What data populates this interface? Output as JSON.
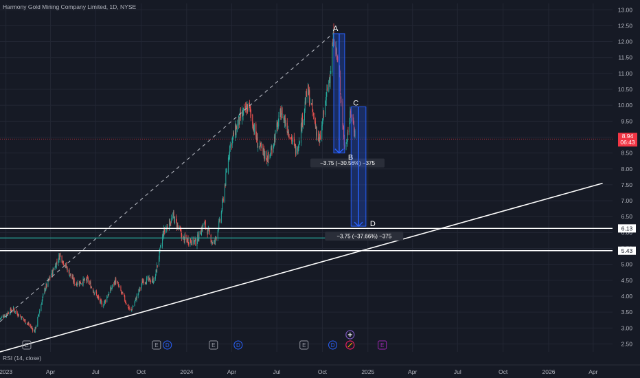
{
  "chart_title": "Harmony Gold Mining Company Limited, 1D, NYSE",
  "indicator_label": "RSI (14, close)",
  "last_price": {
    "value": "8.94",
    "countdown": "06:43"
  },
  "level_labels": {
    "upper": "6.13",
    "lower": "5.43"
  },
  "point_labels": {
    "a": "A",
    "b": "B",
    "c": "C",
    "d": "D"
  },
  "measure_labels": {
    "ab": "−3.75 (−30.56%) −375",
    "cd": "−3.75 (−37.66%) −375"
  },
  "event_marks": [
    "E",
    "E",
    "D",
    "E",
    "D",
    "E",
    "D",
    "E"
  ],
  "colors": {
    "background": "#161a25",
    "up": "#26a69a",
    "down": "#ef5350",
    "measure": "#2962ff",
    "last_price": "#f23645",
    "level": "#ffffff",
    "trendline": "#ffffff",
    "dashed": "#b2b5be",
    "earnings_future": "#9c27b0"
  },
  "icons": [
    "dividend-icon",
    "earnings-icon",
    "plus-icon",
    "split-icon"
  ],
  "chart_data": {
    "type": "candlestick",
    "title": "Harmony Gold Mining Company Limited, 1D, NYSE",
    "x_range": [
      "2022-12-20",
      "2026-05-10"
    ],
    "y_range": [
      2.25,
      13.2
    ],
    "y_ticks": [
      "2.50",
      "3.00",
      "3.50",
      "4.00",
      "4.50",
      "5.00",
      "5.50",
      "6.00",
      "6.50",
      "7.00",
      "7.50",
      "8.00",
      "8.50",
      "9.00",
      "9.50",
      "10.00",
      "10.50",
      "11.00",
      "11.50",
      "12.00",
      "12.50",
      "13.00"
    ],
    "x_ticks": [
      {
        "label": "2023",
        "x": "2023-01-01"
      },
      {
        "label": "Apr",
        "x": "2023-04-01"
      },
      {
        "label": "Jul",
        "x": "2023-07-01"
      },
      {
        "label": "Oct",
        "x": "2023-10-01"
      },
      {
        "label": "2024",
        "x": "2024-01-01"
      },
      {
        "label": "Apr",
        "x": "2024-04-01"
      },
      {
        "label": "Jul",
        "x": "2024-07-01"
      },
      {
        "label": "Oct",
        "x": "2024-10-01"
      },
      {
        "label": "2025",
        "x": "2025-01-01"
      },
      {
        "label": "Apr",
        "x": "2025-04-01"
      },
      {
        "label": "Jul",
        "x": "2025-07-01"
      },
      {
        "label": "Oct",
        "x": "2025-10-01"
      },
      {
        "label": "2026",
        "x": "2026-01-01"
      },
      {
        "label": "Apr",
        "x": "2026-04-01"
      }
    ],
    "price_path": [
      [
        "2022-12-20",
        3.3
      ],
      [
        "2023-01-15",
        3.6
      ],
      [
        "2023-02-10",
        3.2
      ],
      [
        "2023-02-28",
        2.9
      ],
      [
        "2023-03-20",
        4.2
      ],
      [
        "2023-04-20",
        5.3
      ],
      [
        "2023-05-20",
        4.4
      ],
      [
        "2023-06-15",
        4.5
      ],
      [
        "2023-07-15",
        3.7
      ],
      [
        "2023-08-10",
        4.5
      ],
      [
        "2023-09-10",
        3.5
      ],
      [
        "2023-10-05",
        4.5
      ],
      [
        "2023-10-28",
        4.5
      ],
      [
        "2023-11-15",
        6.0
      ],
      [
        "2023-12-05",
        6.5
      ],
      [
        "2023-12-25",
        5.8
      ],
      [
        "2024-01-20",
        5.7
      ],
      [
        "2024-02-05",
        6.3
      ],
      [
        "2024-02-25",
        5.6
      ],
      [
        "2024-03-10",
        6.5
      ],
      [
        "2024-03-28",
        8.7
      ],
      [
        "2024-04-15",
        9.5
      ],
      [
        "2024-05-05",
        10.0
      ],
      [
        "2024-05-25",
        8.7
      ],
      [
        "2024-06-15",
        8.3
      ],
      [
        "2024-07-10",
        9.8
      ],
      [
        "2024-07-25",
        9.2
      ],
      [
        "2024-08-10",
        8.5
      ],
      [
        "2024-09-01",
        10.5
      ],
      [
        "2024-09-25",
        8.8
      ],
      [
        "2024-10-18",
        11.2
      ],
      [
        "2024-10-24",
        12.25
      ],
      [
        "2024-11-04",
        11.0
      ],
      [
        "2024-11-15",
        8.6
      ],
      [
        "2024-11-28",
        9.8
      ],
      [
        "2024-12-08",
        8.94
      ]
    ],
    "annotations": {
      "points": [
        {
          "label": "A",
          "x": "2024-10-24",
          "y": 12.25
        },
        {
          "label": "B",
          "x": "2024-11-15",
          "y": 8.5
        },
        {
          "label": "C",
          "x": "2024-11-28",
          "y": 9.95
        },
        {
          "label": "D",
          "x": "2024-12-28",
          "y": 6.2
        }
      ],
      "horizontal_levels": [
        6.13,
        5.43
      ],
      "dashed_trend": {
        "from": [
          "2022-12-20",
          3.2
        ],
        "to": [
          "2024-10-22",
          12.25
        ]
      },
      "support_trend": {
        "from": [
          "2022-12-20",
          2.25
        ],
        "to": [
          "2026-04-20",
          7.55
        ]
      },
      "measures": [
        {
          "from": [
            "2024-10-24",
            12.25
          ],
          "to": [
            "2024-11-15",
            8.5
          ],
          "text": "−3.75 (−30.56%) −375"
        },
        {
          "from": [
            "2024-11-28",
            9.95
          ],
          "to": [
            "2024-12-28",
            6.2
          ],
          "text": "−3.75 (−37.66%) −375"
        }
      ],
      "teal_line": {
        "y": 5.83,
        "x_end": "2024-10-12"
      },
      "last_price": 8.94
    }
  }
}
